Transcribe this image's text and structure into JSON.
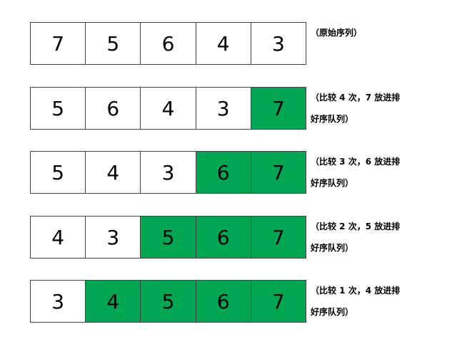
{
  "colors": {
    "sorted_fill": "#00a652",
    "unsorted_fill": "#ffffff",
    "border": "#444444"
  },
  "rows": [
    {
      "cells": [
        {
          "value": "7",
          "sorted": false
        },
        {
          "value": "5",
          "sorted": false
        },
        {
          "value": "6",
          "sorted": false
        },
        {
          "value": "4",
          "sorted": false
        },
        {
          "value": "3",
          "sorted": false
        }
      ],
      "note_lines": [
        "（原始序列）"
      ]
    },
    {
      "cells": [
        {
          "value": "5",
          "sorted": false
        },
        {
          "value": "6",
          "sorted": false
        },
        {
          "value": "4",
          "sorted": false
        },
        {
          "value": "3",
          "sorted": false
        },
        {
          "value": "7",
          "sorted": true
        }
      ],
      "note_lines": [
        "（比较 4 次，7 放进排",
        "好序队列）"
      ]
    },
    {
      "cells": [
        {
          "value": "5",
          "sorted": false
        },
        {
          "value": "4",
          "sorted": false
        },
        {
          "value": "3",
          "sorted": false
        },
        {
          "value": "6",
          "sorted": true
        },
        {
          "value": "7",
          "sorted": true
        }
      ],
      "note_lines": [
        "（比较 3 次，6 放进排",
        "好序队列）"
      ]
    },
    {
      "cells": [
        {
          "value": "4",
          "sorted": false
        },
        {
          "value": "3",
          "sorted": false
        },
        {
          "value": "5",
          "sorted": true
        },
        {
          "value": "6",
          "sorted": true
        },
        {
          "value": "7",
          "sorted": true
        }
      ],
      "note_lines": [
        "（比较 2 次，5 放进排",
        "好序队列）"
      ]
    },
    {
      "cells": [
        {
          "value": "3",
          "sorted": false
        },
        {
          "value": "4",
          "sorted": true
        },
        {
          "value": "5",
          "sorted": true
        },
        {
          "value": "6",
          "sorted": true
        },
        {
          "value": "7",
          "sorted": true
        }
      ],
      "note_lines": [
        "（比较 1 次，4 放进排",
        "好序队列）"
      ]
    }
  ]
}
